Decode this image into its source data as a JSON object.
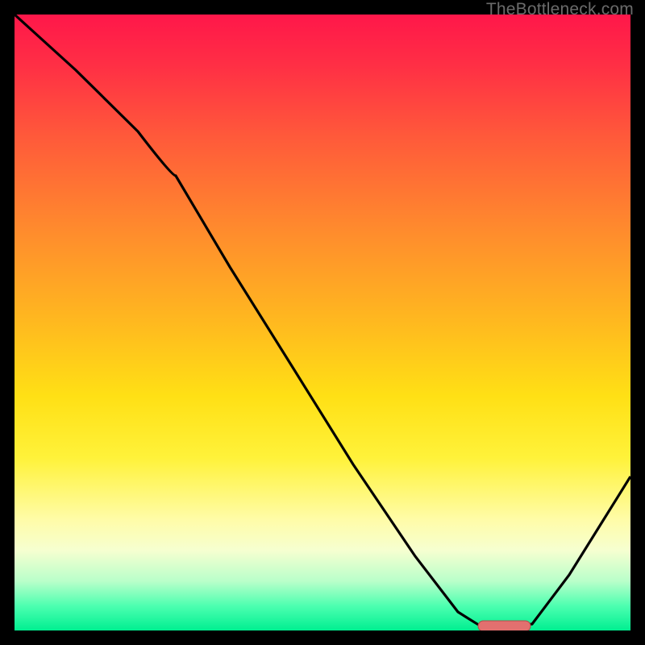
{
  "watermark": {
    "text": "TheBottleneck.com"
  },
  "colors": {
    "frame": "#000000",
    "curve": "#000000",
    "marker_fill": "#e2706f",
    "marker_stroke": "#b24b4a"
  },
  "chart_data": {
    "type": "line",
    "title": "",
    "xlabel": "",
    "ylabel": "",
    "xlim": [
      0,
      1
    ],
    "ylim": [
      0,
      1
    ],
    "note": "Axes unlabeled in source image; x and y normalized 0–1. y is bottleneck severity (1 = worst / red top, 0 = best / green bottom). Curve descends from top-left, flattens near x≈0.78, then rises toward right edge.",
    "series": [
      {
        "name": "bottleneck-curve",
        "x": [
          0.0,
          0.1,
          0.2,
          0.26,
          0.35,
          0.45,
          0.55,
          0.65,
          0.72,
          0.76,
          0.8,
          0.84,
          0.9,
          0.95,
          1.0
        ],
        "y": [
          1.0,
          0.91,
          0.81,
          0.74,
          0.59,
          0.43,
          0.27,
          0.12,
          0.03,
          0.005,
          0.005,
          0.01,
          0.09,
          0.17,
          0.25
        ]
      }
    ],
    "marker": {
      "name": "optimal-range",
      "shape": "rounded-bar",
      "x_center": 0.795,
      "y": 0.007,
      "width": 0.085,
      "height": 0.018
    },
    "background_gradient": {
      "direction": "vertical",
      "stops": [
        {
          "pos": 0.0,
          "color": "#ff174a"
        },
        {
          "pos": 0.5,
          "color": "#ffb91f"
        },
        {
          "pos": 0.82,
          "color": "#fffca8"
        },
        {
          "pos": 1.0,
          "color": "#00ef91"
        }
      ]
    }
  }
}
